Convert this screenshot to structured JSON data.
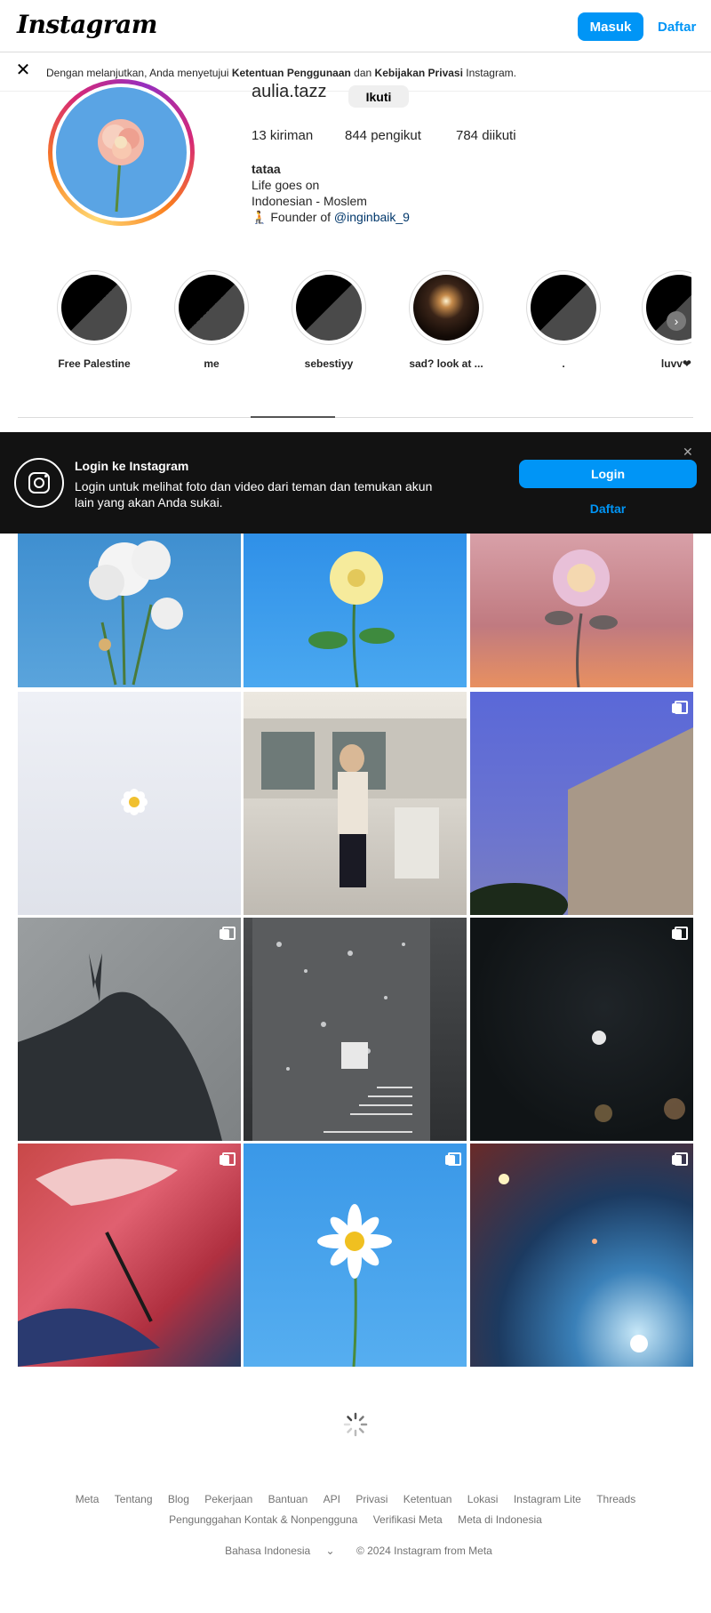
{
  "topbar": {
    "logo": "Instagram",
    "login_label": "Masuk",
    "signup_label": "Daftar"
  },
  "notice": {
    "prefix": "Dengan melanjutkan, Anda menyetujui ",
    "terms": "Ketentuan Penggunaan",
    "middle": " dan ",
    "privacy": "Kebijakan Privasi",
    "suffix": " Instagram."
  },
  "profile": {
    "username": "aulia.tazz",
    "follow_label": "Ikuti",
    "posts": "13 kiriman",
    "followers": "844 pengikut",
    "following": "784 diikuti",
    "name": "tataa",
    "bio_line1": "Life goes on",
    "bio_line2": "Indonesian - Moslem",
    "bio_line3_prefix": "🧎 Founder of ",
    "bio_link": "@inginbaik_9"
  },
  "highlights": [
    {
      "label": "Free Palestine"
    },
    {
      "label": "me"
    },
    {
      "label": "sebestiyy"
    },
    {
      "label": "sad? look at ..."
    },
    {
      "label": "."
    },
    {
      "label": "luvv❤"
    }
  ],
  "banner": {
    "title": "Login ke Instagram",
    "text": "Login untuk melihat foto dan video dari teman dan temukan akun lain yang akan Anda sukai.",
    "login_label": "Login",
    "signup_label": "Daftar",
    "close": "✕"
  },
  "footer": {
    "links_row1": [
      "Meta",
      "Tentang",
      "Blog",
      "Pekerjaan",
      "Bantuan",
      "API",
      "Privasi",
      "Ketentuan",
      "Lokasi",
      "Instagram Lite",
      "Threads"
    ],
    "links_row2": [
      "Pengunggahan Kontak & Nonpengguna",
      "Verifikasi Meta",
      "Meta di Indonesia"
    ],
    "language": "Bahasa Indonesia",
    "copyright": "© 2024 Instagram from Meta"
  }
}
